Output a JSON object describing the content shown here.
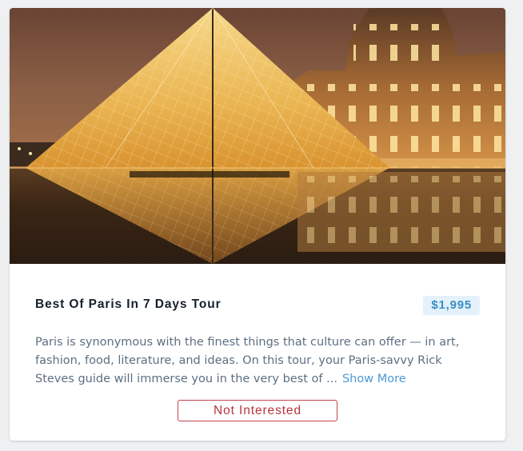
{
  "tour": {
    "title": "Best Of Paris In 7 Days Tour",
    "price": "$1,995",
    "description": "Paris is synonymous with the finest things that culture can offer — in art, fashion, food, literature, and ideas. On this tour, your Paris-savvy Rick Steves guide will immerse you in the very best of ...",
    "show_more_label": "Show More",
    "not_interested_label": "Not Interested"
  },
  "colors": {
    "price_text": "#3a8fc6",
    "price_bg": "#e4f1fa",
    "link": "#4a9ad6",
    "button_border": "#c4444b",
    "title": "#16202c",
    "body_text": "#5d6f82"
  }
}
